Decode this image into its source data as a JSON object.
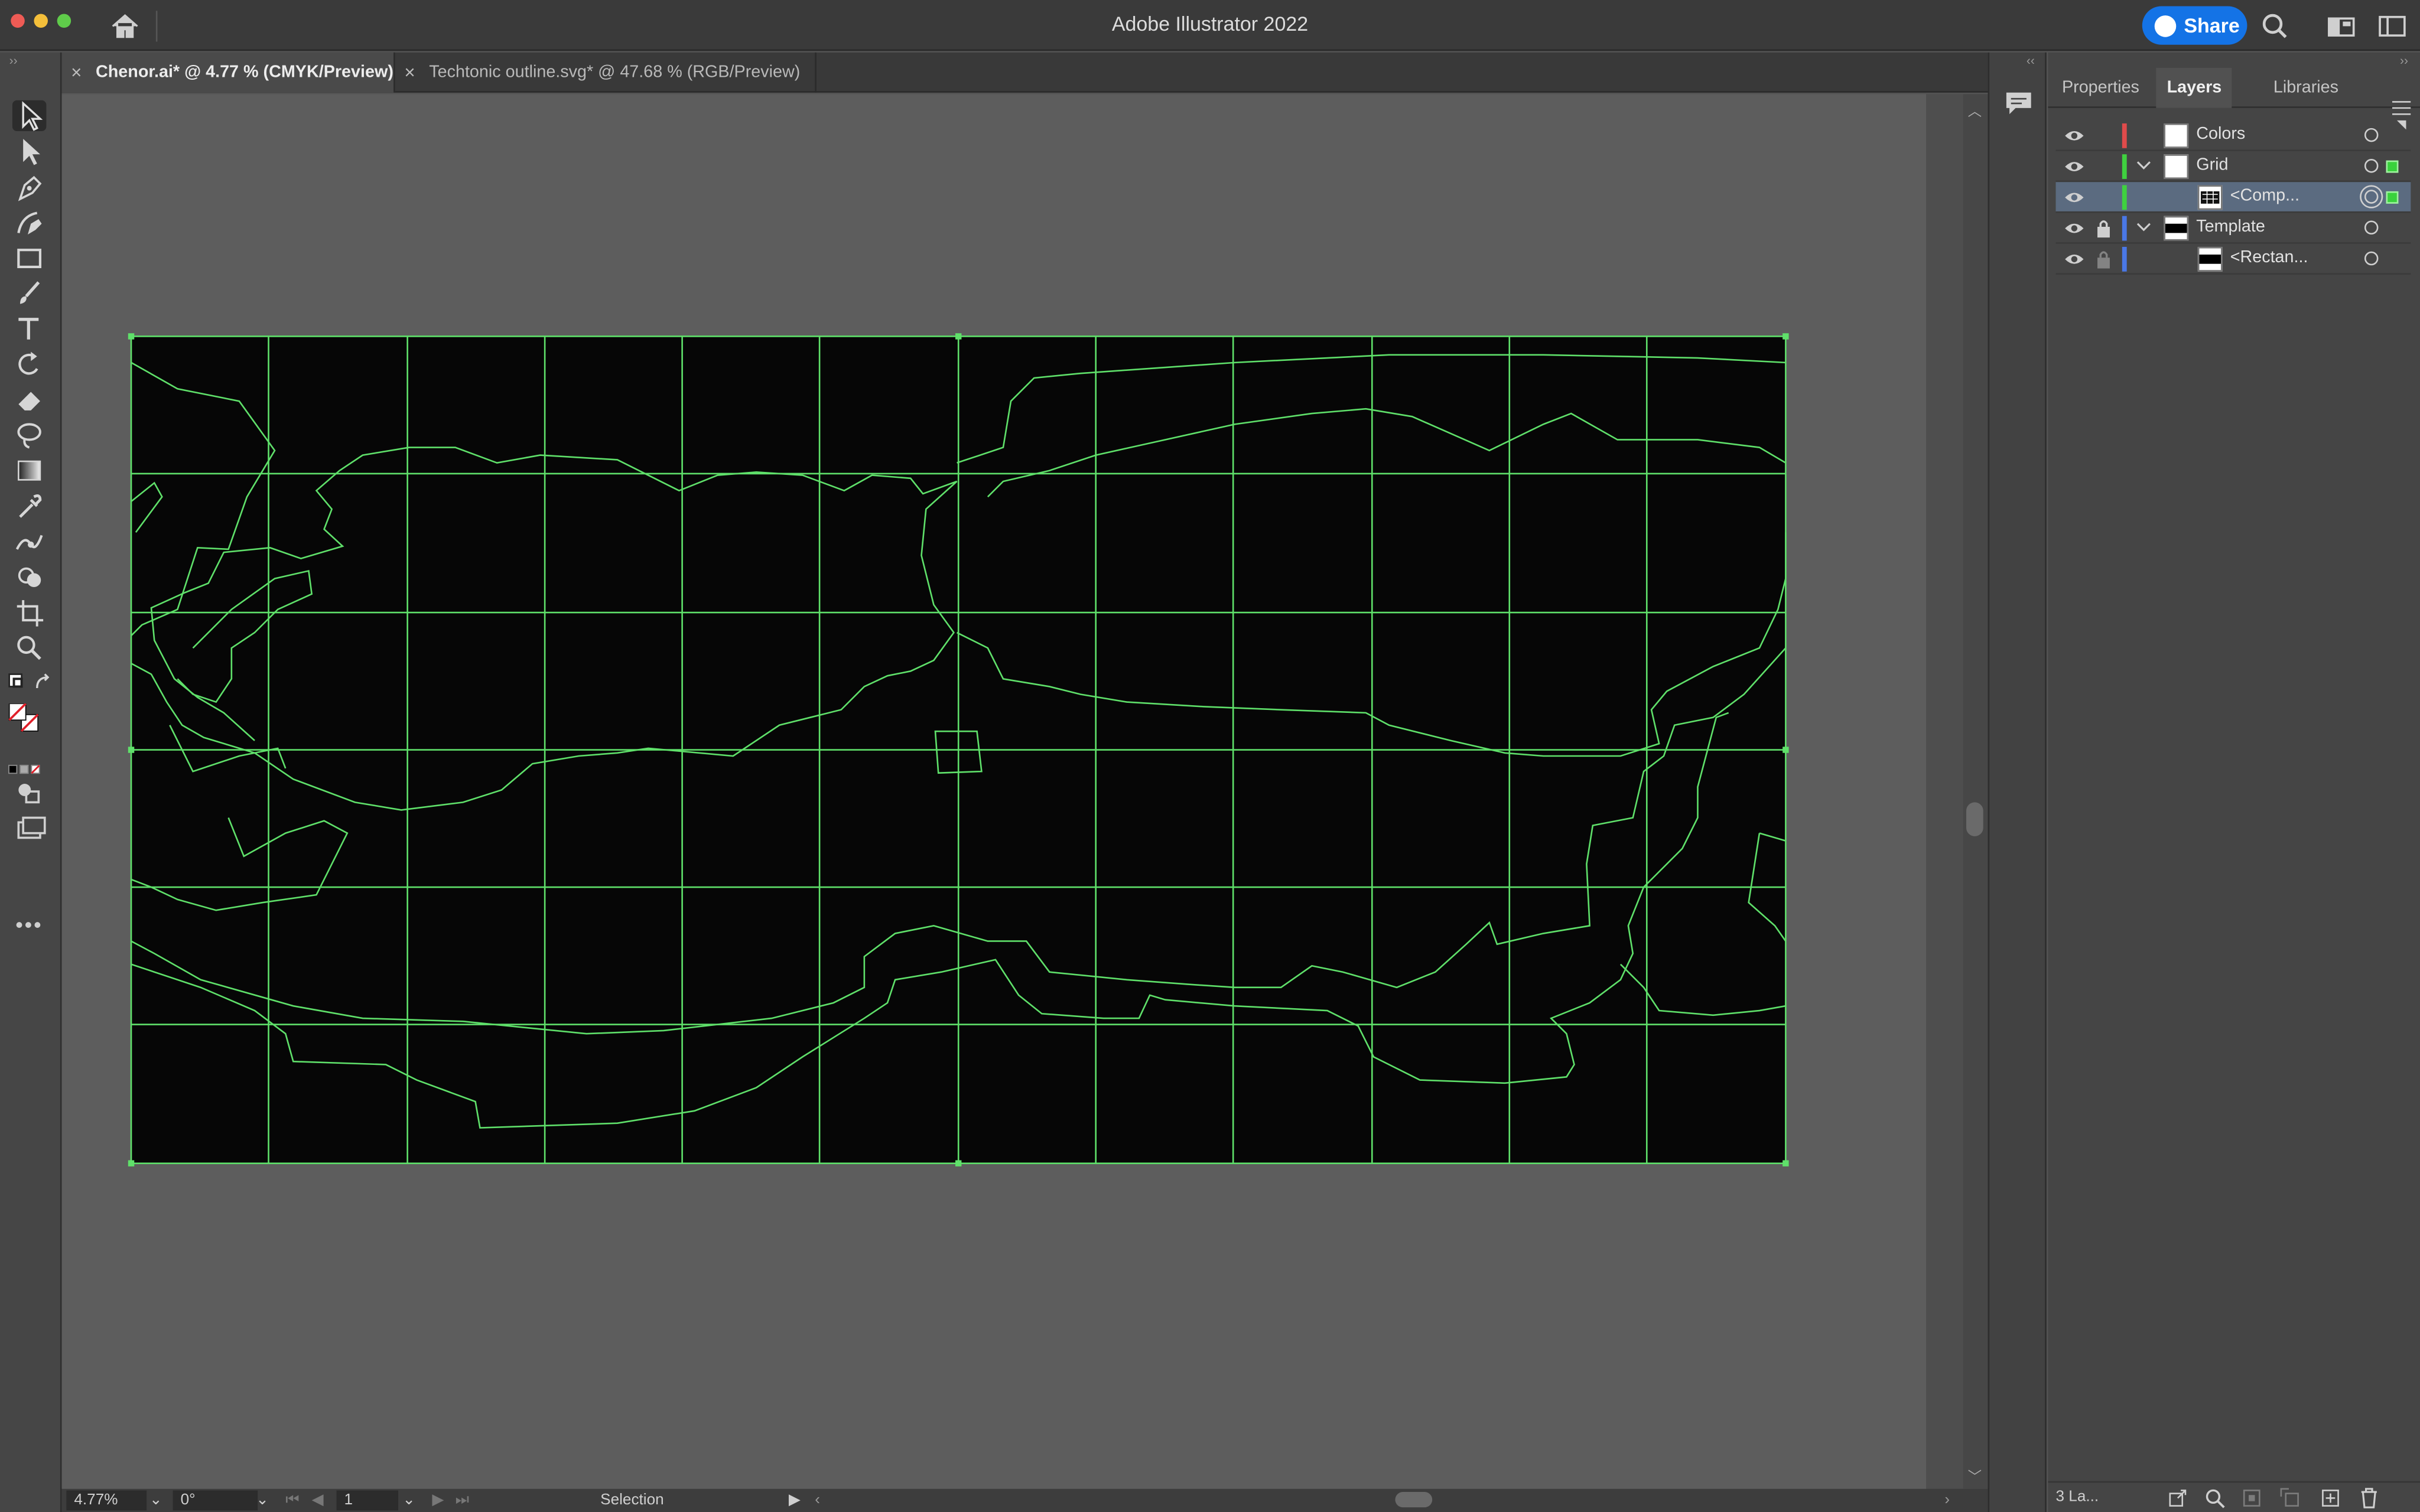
{
  "window": {
    "title": "Adobe Illustrator 2022",
    "share_label": "Share"
  },
  "tabs": [
    {
      "label": "Chenor.ai* @ 4.77 % (CMYK/Preview)",
      "close": "×"
    },
    {
      "label": "Techtonic outline.svg* @ 47.68 % (RGB/Preview)",
      "close": "×"
    }
  ],
  "tools": [
    "selection-tool",
    "direct-selection-tool",
    "pen-tool",
    "curvature-tool",
    "rectangle-tool",
    "paintbrush-tool",
    "type-tool",
    "rotate-tool",
    "eraser-tool",
    "lasso-tool",
    "gradient-tool",
    "eyedropper-tool",
    "puppet-warp-tool",
    "shape-builder-tool",
    "artboard-tool",
    "zoom-tool"
  ],
  "more_tools": "•••",
  "status": {
    "zoom": "4.77%",
    "rotation": "0°",
    "artboard": "1",
    "mode": "Selection"
  },
  "panel": {
    "tabs": [
      "Properties",
      "Layers",
      "Libraries"
    ],
    "active_tab": "Layers",
    "layers": [
      {
        "name": "Colors",
        "color": "#e04b4b",
        "locked": false,
        "expanded": null,
        "indent": 0
      },
      {
        "name": "Grid",
        "color": "#3fd13f",
        "locked": false,
        "expanded": true,
        "indent": 0
      },
      {
        "name": "<Comp...",
        "color": "#3fd13f",
        "locked": false,
        "expanded": null,
        "indent": 1,
        "selected": true
      },
      {
        "name": "Template",
        "color": "#4a78e6",
        "locked": true,
        "expanded": true,
        "indent": 0
      },
      {
        "name": "<Rectan...",
        "color": "#4a78e6",
        "locked": true,
        "expanded": null,
        "indent": 1
      }
    ],
    "footer_label": "3 La..."
  },
  "colors": {
    "accent": "#1473e6",
    "guide_green": "#5fe06a",
    "artboard_fill": "#060606"
  }
}
